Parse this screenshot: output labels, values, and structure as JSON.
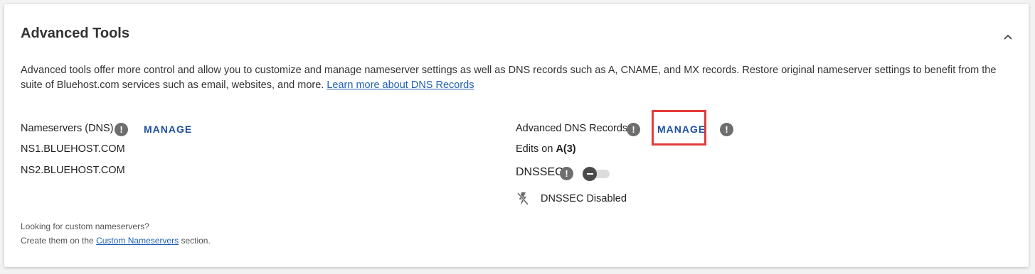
{
  "panel": {
    "title": "Advanced Tools",
    "description_text": "Advanced tools offer more control and allow you to customize and manage nameserver settings as well as DNS records such as A, CNAME, and MX records. Restore original nameserver settings to benefit from the suite of Bluehost.com services such as email, websites, and more.",
    "description_link": "Learn more about DNS Records"
  },
  "nameservers": {
    "label": "Nameservers (DNS)",
    "manage_label": "MANAGE",
    "items": [
      "NS1.BLUEHOST.COM",
      "NS2.BLUEHOST.COM"
    ]
  },
  "dns_records": {
    "label": "Advanced DNS Records",
    "manage_label": "MANAGE",
    "edits_prefix": "Edits on",
    "edits_value": "A(3)"
  },
  "dnssec": {
    "label": "DNSSEC",
    "enabled": false,
    "status_text": "DNSSEC Disabled"
  },
  "footer": {
    "line1": "Looking for custom nameservers?",
    "line2_prefix": "Create them on the",
    "line2_link": "Custom Nameservers",
    "line2_suffix": "section."
  },
  "info_glyph": "!",
  "colors": {
    "link": "#1e5fb4",
    "manage": "#1e4fa0",
    "highlight": "#e53b3b",
    "info_icon": "#6e6e6e"
  }
}
